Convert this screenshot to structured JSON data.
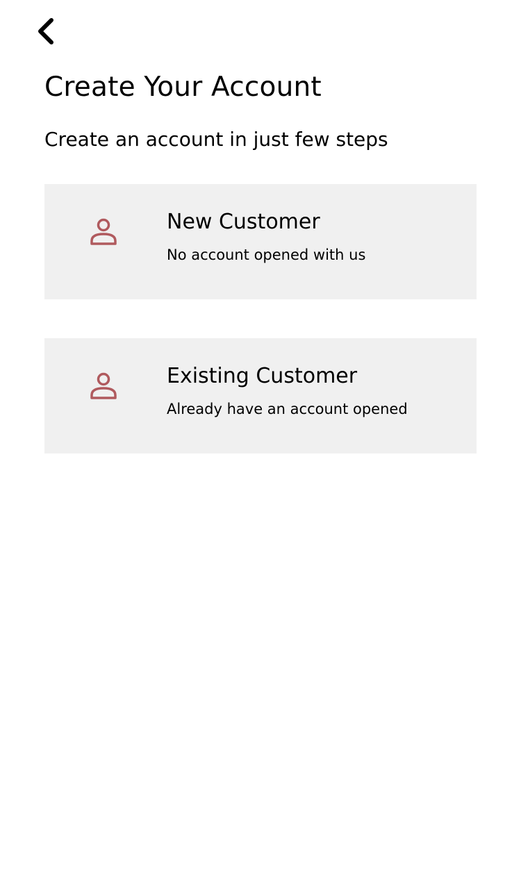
{
  "header": {
    "back_icon": "chevron-left-icon"
  },
  "title": "Create Your Account",
  "subtitle": "Create an account in just few steps",
  "accent_color": "#b05a5e",
  "card_background": "#f0f0f0",
  "options": [
    {
      "icon": "user-icon",
      "title": "New Customer",
      "description": "No account opened with us"
    },
    {
      "icon": "user-icon",
      "title": "Existing Customer",
      "description": "Already have an account opened"
    }
  ]
}
